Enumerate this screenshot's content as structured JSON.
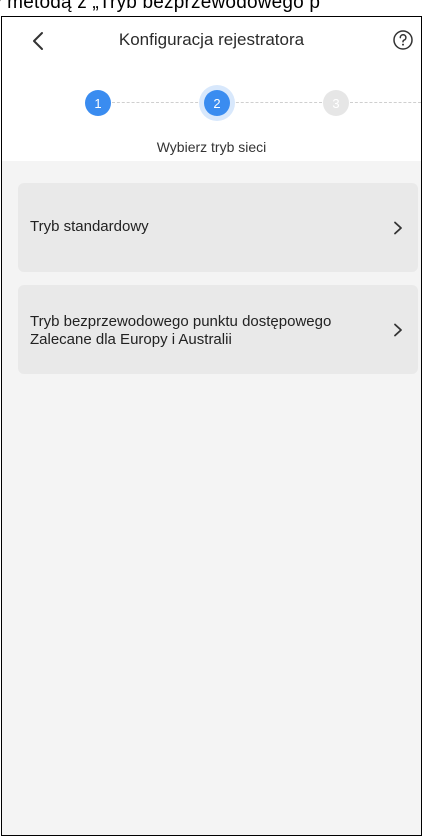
{
  "caption": "y metodą z „Tryb bezprzewodowego p",
  "header": {
    "title": "Konfiguracja rejestratora",
    "back_icon": "chevron-left-icon",
    "help_icon": "question-circle-icon"
  },
  "stepper": {
    "steps": [
      {
        "number": "1",
        "state": "done"
      },
      {
        "number": "2",
        "state": "active"
      },
      {
        "number": "3",
        "state": "todo"
      }
    ],
    "current_label": "Wybierz tryb sieci"
  },
  "options": [
    {
      "line1": "Tryb standardowy",
      "line2": ""
    },
    {
      "line1": "Tryb bezprzewodowego punktu dostępowego",
      "line2": "Zalecane dla Europy i Australii"
    }
  ],
  "colors": {
    "accent": "#3a8cf0",
    "step_inactive": "#e6e6e6",
    "option_bg": "#e9e9e9",
    "content_bg": "#f4f4f4"
  }
}
